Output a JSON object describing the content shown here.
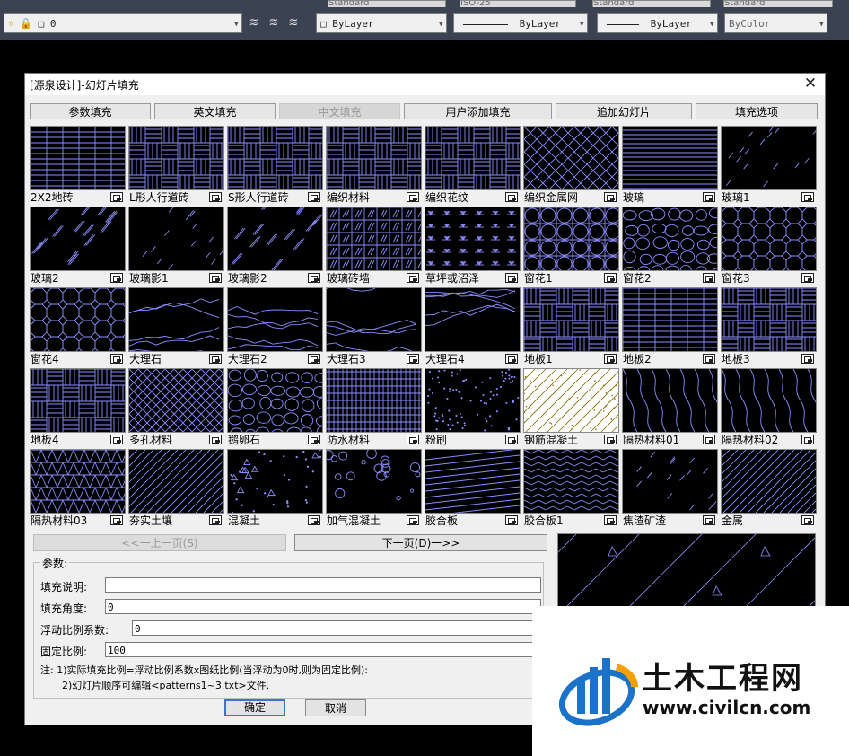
{
  "toolbar": {
    "top_strip": [
      "Standard",
      "ISO-25",
      "Standard",
      "Standard"
    ],
    "layer_value": "0",
    "color_value": "ByLayer",
    "linetype_value": "ByLayer",
    "lineweight_value": "ByLayer",
    "plotstyle_value": "ByColor"
  },
  "dialog": {
    "title": "[源泉设计]-幻灯片填充",
    "close": "✕"
  },
  "tabs": [
    {
      "label": "参数填充",
      "active": false
    },
    {
      "label": "英文填充",
      "active": false
    },
    {
      "label": "中文填充",
      "active": true
    },
    {
      "label": "用户添加填充",
      "active": false
    },
    {
      "label": "追加幻灯片",
      "active": false
    },
    {
      "label": "填充选项",
      "active": false
    }
  ],
  "patterns": [
    {
      "label": "2X2地砖",
      "kind": "bricks"
    },
    {
      "label": "L形人行道砖",
      "kind": "lbrick"
    },
    {
      "label": "S形人行道砖",
      "kind": "sbrick"
    },
    {
      "label": "编织材料",
      "kind": "weave"
    },
    {
      "label": "编织花纹",
      "kind": "weave2"
    },
    {
      "label": "编织金属网",
      "kind": "diamond"
    },
    {
      "label": "玻璃",
      "kind": "hlines"
    },
    {
      "label": "玻璃1",
      "kind": "dashes"
    },
    {
      "label": "玻璃2",
      "kind": "glass"
    },
    {
      "label": "玻璃影1",
      "kind": "dashes"
    },
    {
      "label": "玻璃影2",
      "kind": "glass"
    },
    {
      "label": "玻璃砖墙",
      "kind": "glassbrick"
    },
    {
      "label": "草坪或沼泽",
      "kind": "grass"
    },
    {
      "label": "窗花1",
      "kind": "circles"
    },
    {
      "label": "窗花2",
      "kind": "stones"
    },
    {
      "label": "窗花3",
      "kind": "octa"
    },
    {
      "label": "窗花4",
      "kind": "octa"
    },
    {
      "label": "大理石",
      "kind": "marble"
    },
    {
      "label": "大理石2",
      "kind": "marble"
    },
    {
      "label": "大理石3",
      "kind": "marble"
    },
    {
      "label": "大理石4",
      "kind": "marble"
    },
    {
      "label": "地板1",
      "kind": "weave"
    },
    {
      "label": "地板2",
      "kind": "bricks"
    },
    {
      "label": "地板3",
      "kind": "herring"
    },
    {
      "label": "地板4",
      "kind": "weave"
    },
    {
      "label": "多孔材料",
      "kind": "crosshatch"
    },
    {
      "label": "鹅卵石",
      "kind": "stones"
    },
    {
      "label": "防水材料",
      "kind": "grid"
    },
    {
      "label": "粉刷",
      "kind": "dots"
    },
    {
      "label": "钢筋混凝土",
      "kind": "rc"
    },
    {
      "label": "隔热材料01",
      "kind": "wave"
    },
    {
      "label": "隔热材料02",
      "kind": "wave"
    },
    {
      "label": "隔热材料03",
      "kind": "tri"
    },
    {
      "label": "夯实土壤",
      "kind": "diag"
    },
    {
      "label": "混凝土",
      "kind": "concrete"
    },
    {
      "label": "加气混凝土",
      "kind": "bubbles"
    },
    {
      "label": "胶合板",
      "kind": "diaghlines"
    },
    {
      "label": "胶合板1",
      "kind": "chevron"
    },
    {
      "label": "焦渣矿渣",
      "kind": "dashes"
    },
    {
      "label": "金属",
      "kind": "diag"
    }
  ],
  "nav": {
    "prev": "<<一上一页(S)",
    "next": "下一页(D)一>>"
  },
  "params": {
    "group_title": "参数:",
    "desc_label": "填充说明:",
    "desc_value": "",
    "angle_label": "填充角度:",
    "angle_value": "0",
    "float_label": "浮动比例系数:",
    "float_value": "0",
    "fixed_label": "固定比例:",
    "fixed_value": "100",
    "note1": "注: 1)实际填充比例=浮动比例系数x图纸比例(当浮动为0时,则为固定比例):",
    "note2": "2)幻灯片顺序可编辑<patterns1~3.txt>文件."
  },
  "buttons": {
    "ok": "确定",
    "cancel": "取消"
  },
  "watermark": {
    "title": "土木工程网",
    "url": "www.civilcn.com"
  },
  "colors": {
    "pattern": "#8b8dff",
    "toolbar": "#3b4352",
    "dialog": "#f0f0f0"
  }
}
